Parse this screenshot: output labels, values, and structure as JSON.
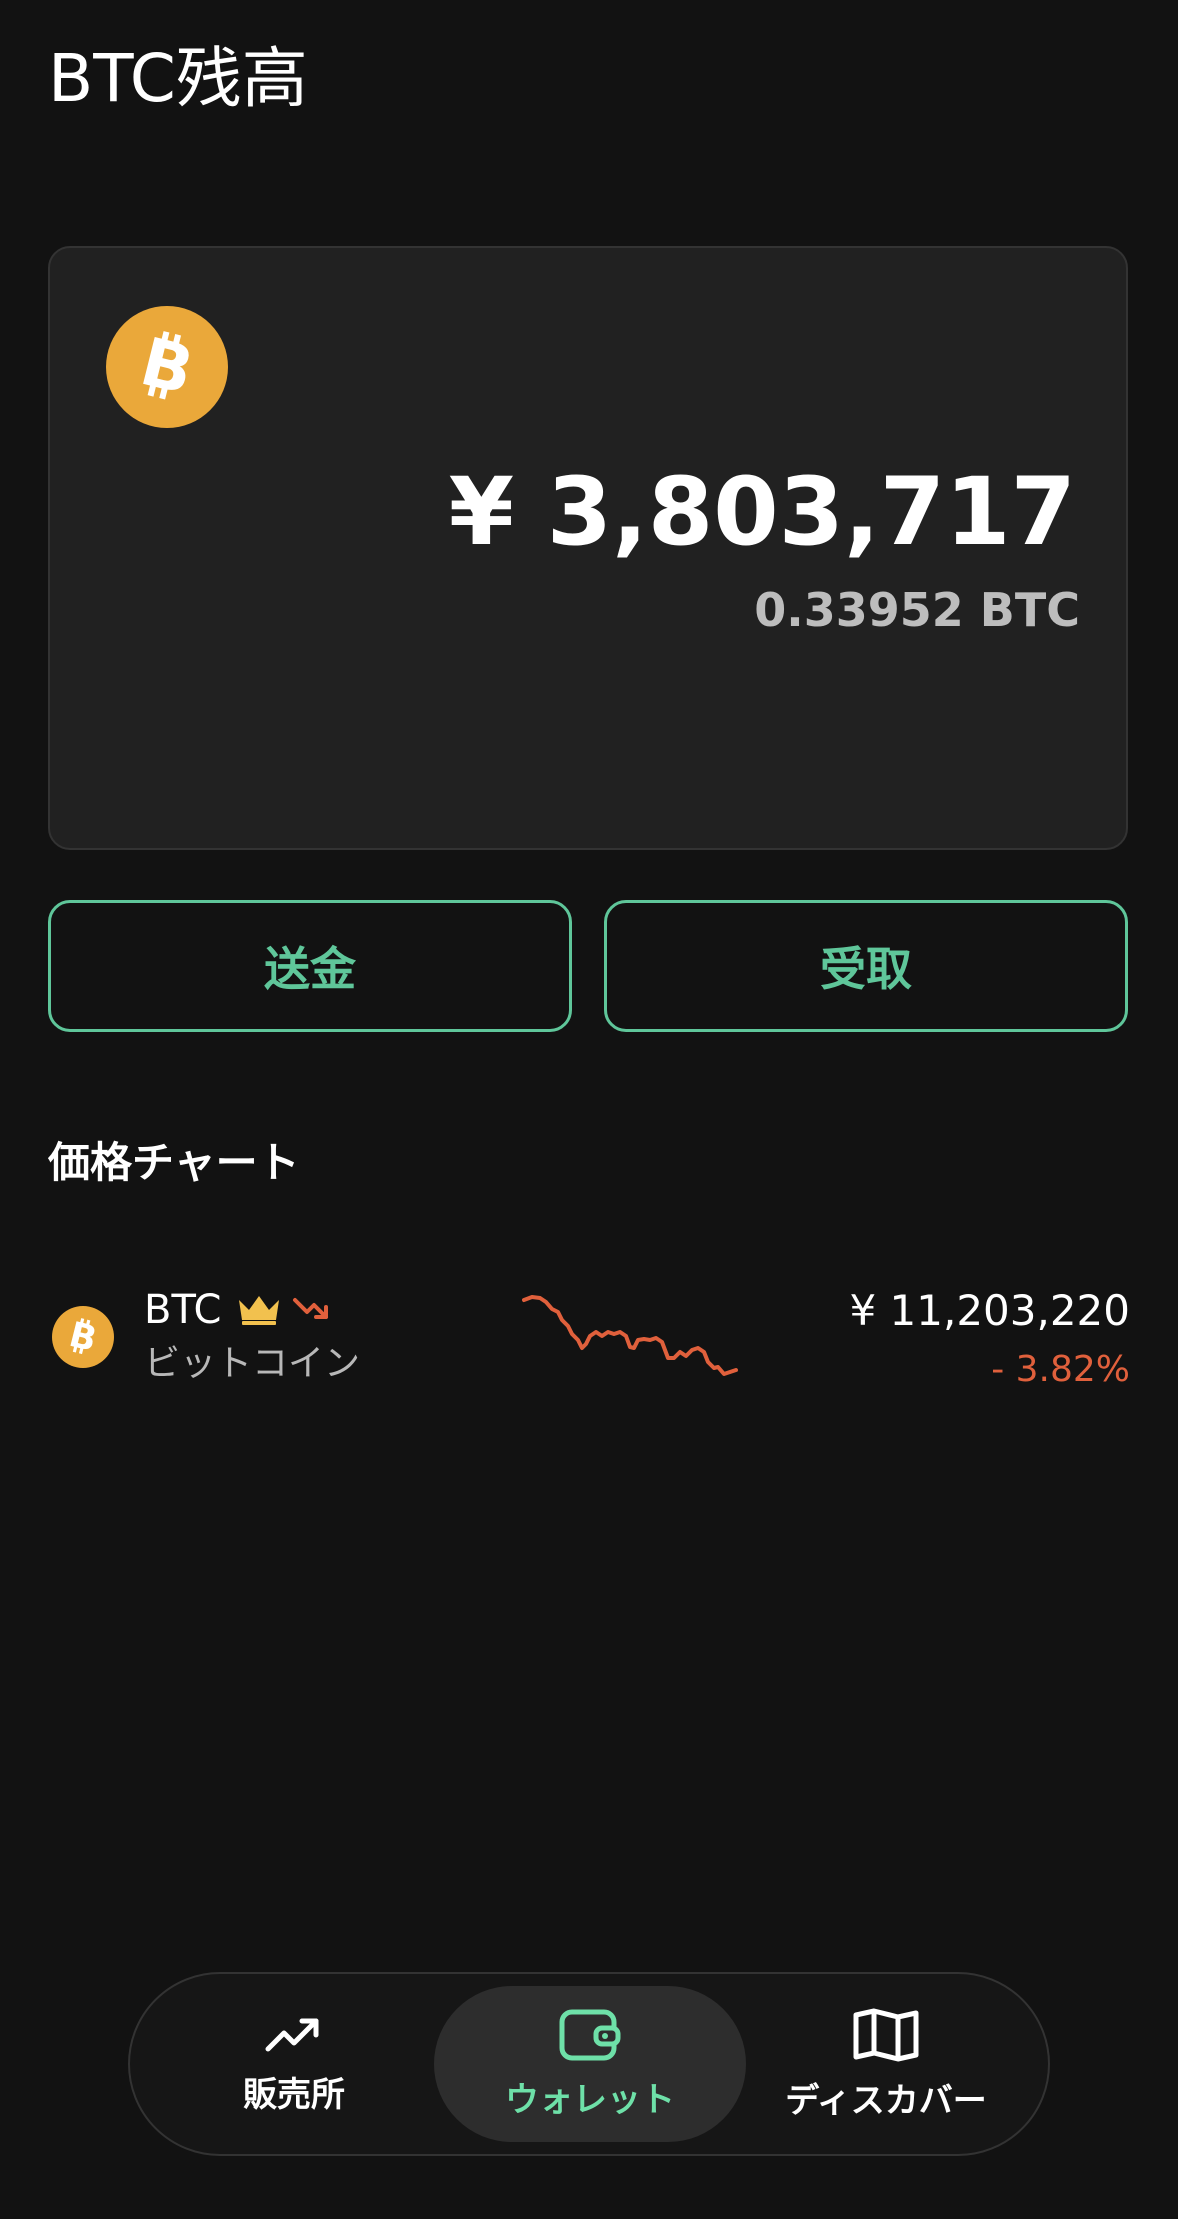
{
  "page": {
    "title": "BTC残高"
  },
  "balance": {
    "jpy": "¥ 3,803,717",
    "btc": "0.33952 BTC",
    "coin_icon": "bitcoin-icon"
  },
  "actions": {
    "send_label": "送金",
    "receive_label": "受取"
  },
  "chart_section": {
    "title": "価格チャート",
    "assets": [
      {
        "symbol": "BTC",
        "name": "ビットコイン",
        "price": "¥ 11,203,220",
        "change": "- 3.82%",
        "badges": [
          "crown-icon",
          "trend-down-icon"
        ],
        "sparkline_color": "#e0603c"
      }
    ]
  },
  "nav": {
    "items": [
      {
        "label": "販売所",
        "icon": "trend-up-icon",
        "active": false
      },
      {
        "label": "ウォレット",
        "icon": "wallet-icon",
        "active": true
      },
      {
        "label": "ディスカバー",
        "icon": "map-icon",
        "active": false
      }
    ]
  },
  "colors": {
    "background": "#121212",
    "card": "#212121",
    "accent_green": "#5fc69a",
    "active_nav_green": "#6ee0a8",
    "bitcoin_orange": "#eaa83a",
    "negative_red": "#e0603c"
  }
}
